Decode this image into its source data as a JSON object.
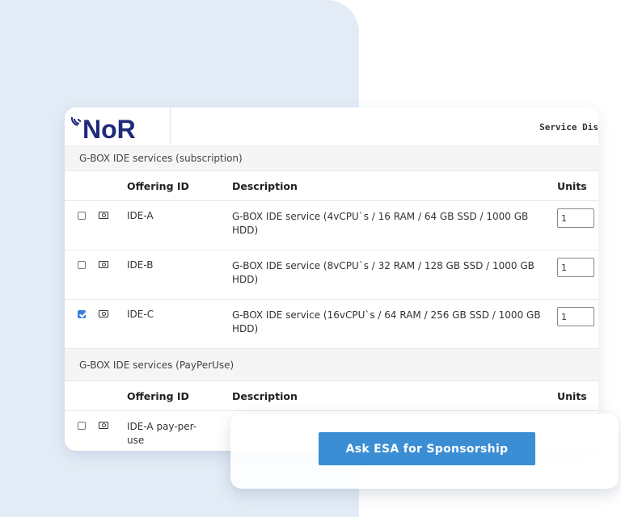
{
  "header": {
    "logo_text": "NoR",
    "right_text": "Service Dis"
  },
  "sections": [
    {
      "title": "G-BOX IDE services (subscription)",
      "columns": {
        "offering_id": "Offering ID",
        "description": "Description",
        "units": "Units"
      },
      "rows": [
        {
          "checked": false,
          "offering_id": "IDE-A",
          "description": "G-BOX IDE service (4vCPU`s / 16 RAM / 64 GB SSD / 1000 GB HDD)",
          "units": "1"
        },
        {
          "checked": false,
          "offering_id": "IDE-B",
          "description": "G-BOX IDE service (8vCPU`s / 32 RAM / 128 GB SSD / 1000 GB HDD)",
          "units": "1"
        },
        {
          "checked": true,
          "offering_id": "IDE-C",
          "description": "G-BOX IDE service (16vCPU`s / 64 RAM / 256 GB SSD / 1000 GB HDD)",
          "units": "1"
        }
      ]
    },
    {
      "title": "G-BOX IDE services (PayPerUse)",
      "columns": {
        "offering_id": "Offering ID",
        "description": "Description",
        "units": "Units"
      },
      "rows": [
        {
          "checked": false,
          "offering_id": "IDE-A pay-per-use",
          "description": "",
          "units": ""
        }
      ]
    }
  ],
  "overlay": {
    "button_label": "Ask ESA for Sponsorship"
  },
  "colors": {
    "background_shape": "#e3ebf6",
    "button": "#3b8ed4",
    "checkbox_checked": "#3b7ddd",
    "logo": "#1f2a7a"
  },
  "icons": {
    "row_icon": "cash-icon",
    "logo_mark": "signal-waves-icon"
  }
}
